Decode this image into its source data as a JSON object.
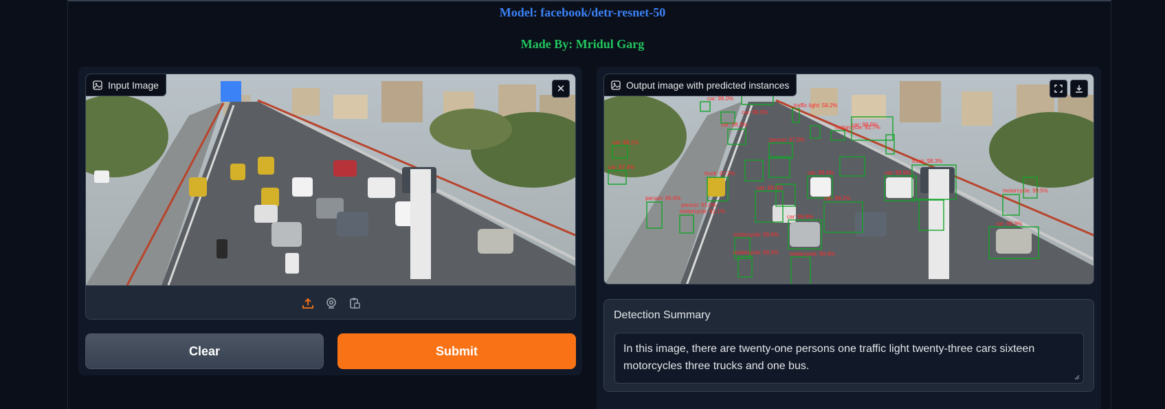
{
  "header": {
    "model_line": "Model: facebook/detr-resnet-50",
    "author_line": "Made By: Mridul Garg"
  },
  "input": {
    "label": "Input Image",
    "label_icon": "image-icon",
    "close_icon": "close-icon",
    "close_glyph": "✕",
    "tools": [
      "upload-icon",
      "webcam-icon",
      "clipboard-icon"
    ]
  },
  "buttons": {
    "clear_label": "Clear",
    "submit_label": "Submit"
  },
  "output": {
    "label": "Output image with predicted instances",
    "label_icon": "image-icon",
    "fullscreen_icon": "fullscreen-icon",
    "download_icon": "download-icon"
  },
  "summary": {
    "label": "Detection Summary",
    "text": "In this image, there are twenty-one persons one traffic light twenty-three cars sixteen motorcycles three trucks and one bus."
  },
  "colors": {
    "accent": "#f97316",
    "model_text": "#3b82f6",
    "author_text": "#22c55e",
    "box_color": "#15a32a",
    "box_label": "#ff2a2a"
  }
}
